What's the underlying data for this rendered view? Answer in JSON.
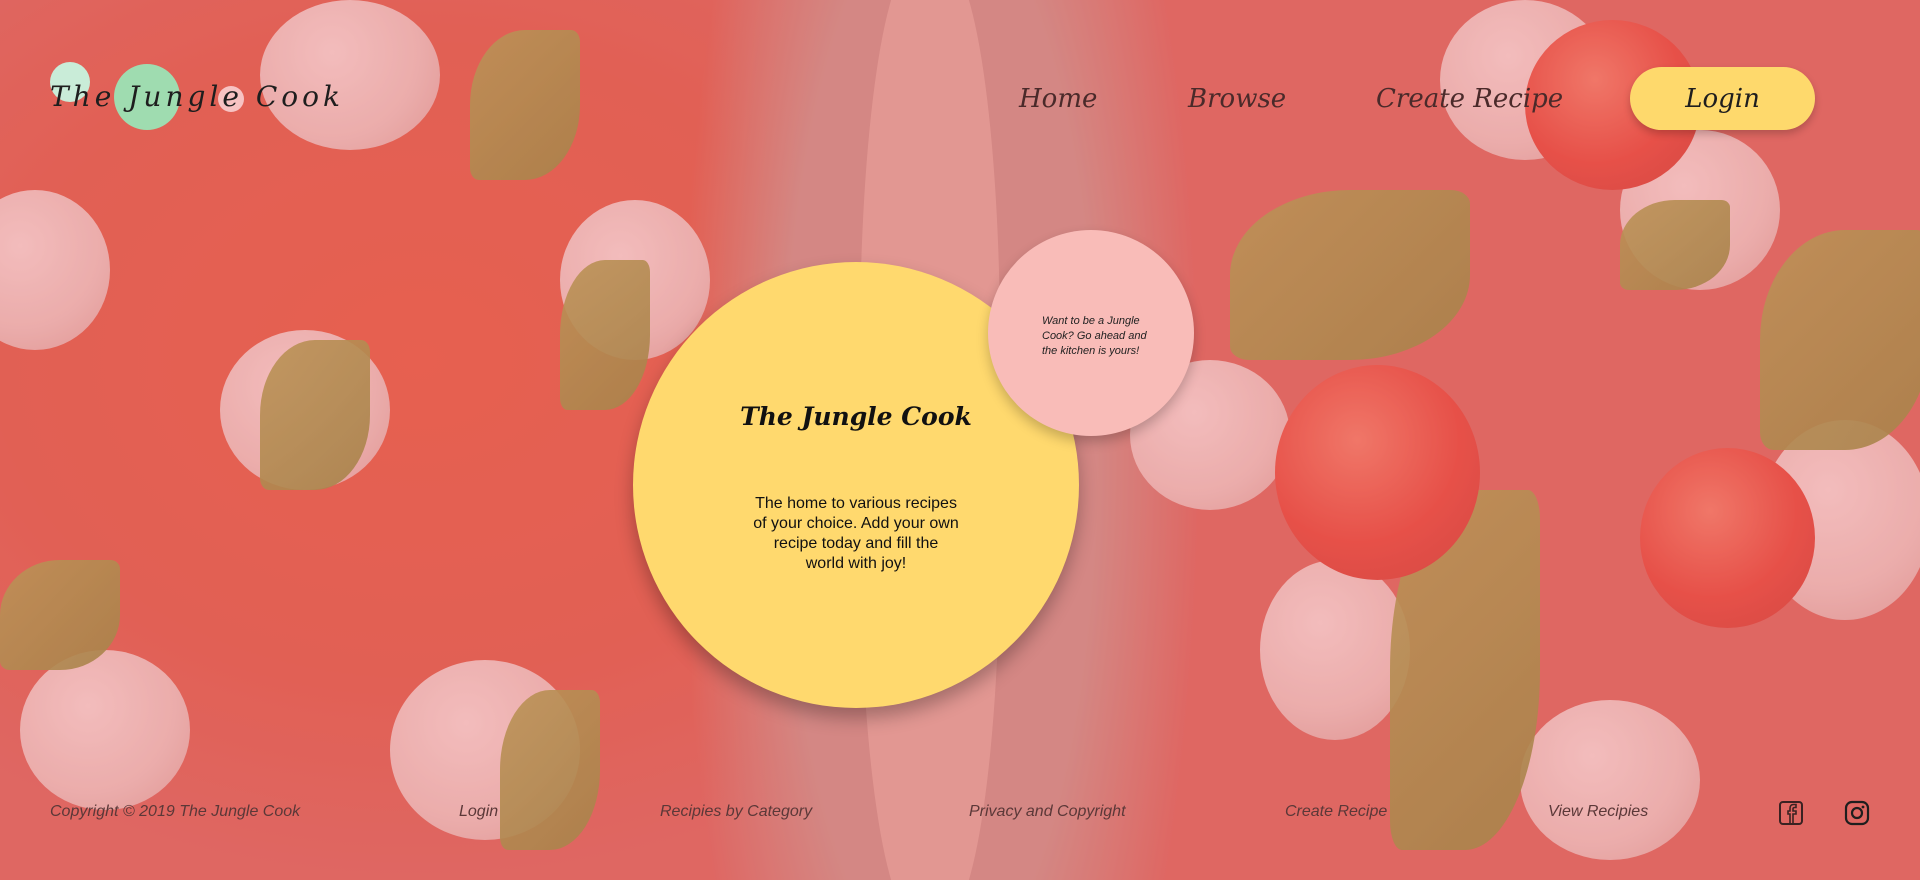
{
  "header": {
    "logo_text": "The Jungle Cook",
    "nav": [
      {
        "label": "Home"
      },
      {
        "label": "Browse"
      },
      {
        "label": "Create Recipe"
      }
    ],
    "login_label": "Login"
  },
  "hero": {
    "title": "The Jungle Cook",
    "text": "The home to various recipes of your choice. Add your own recipe today and fill the world with joy!",
    "badge_text": "Want to be a Jungle Cook? Go ahead and the kitchen is yours!"
  },
  "footer": {
    "copyright": "Copyright © 2019 The Jungle Cook",
    "links": [
      {
        "label": "Login"
      },
      {
        "label": "Recipies by Category"
      },
      {
        "label": "Privacy and Copyright"
      },
      {
        "label": "Create Recipe"
      },
      {
        "label": "View Recipies"
      }
    ],
    "social_icons": [
      "facebook-icon",
      "instagram-icon"
    ]
  },
  "colors": {
    "overlay": "#f06e6e",
    "hero_circle": "#ffd96e",
    "badge_circle": "#f9bcb8",
    "login_button": "#fed96c",
    "logo_green": "#9fdcb0"
  }
}
